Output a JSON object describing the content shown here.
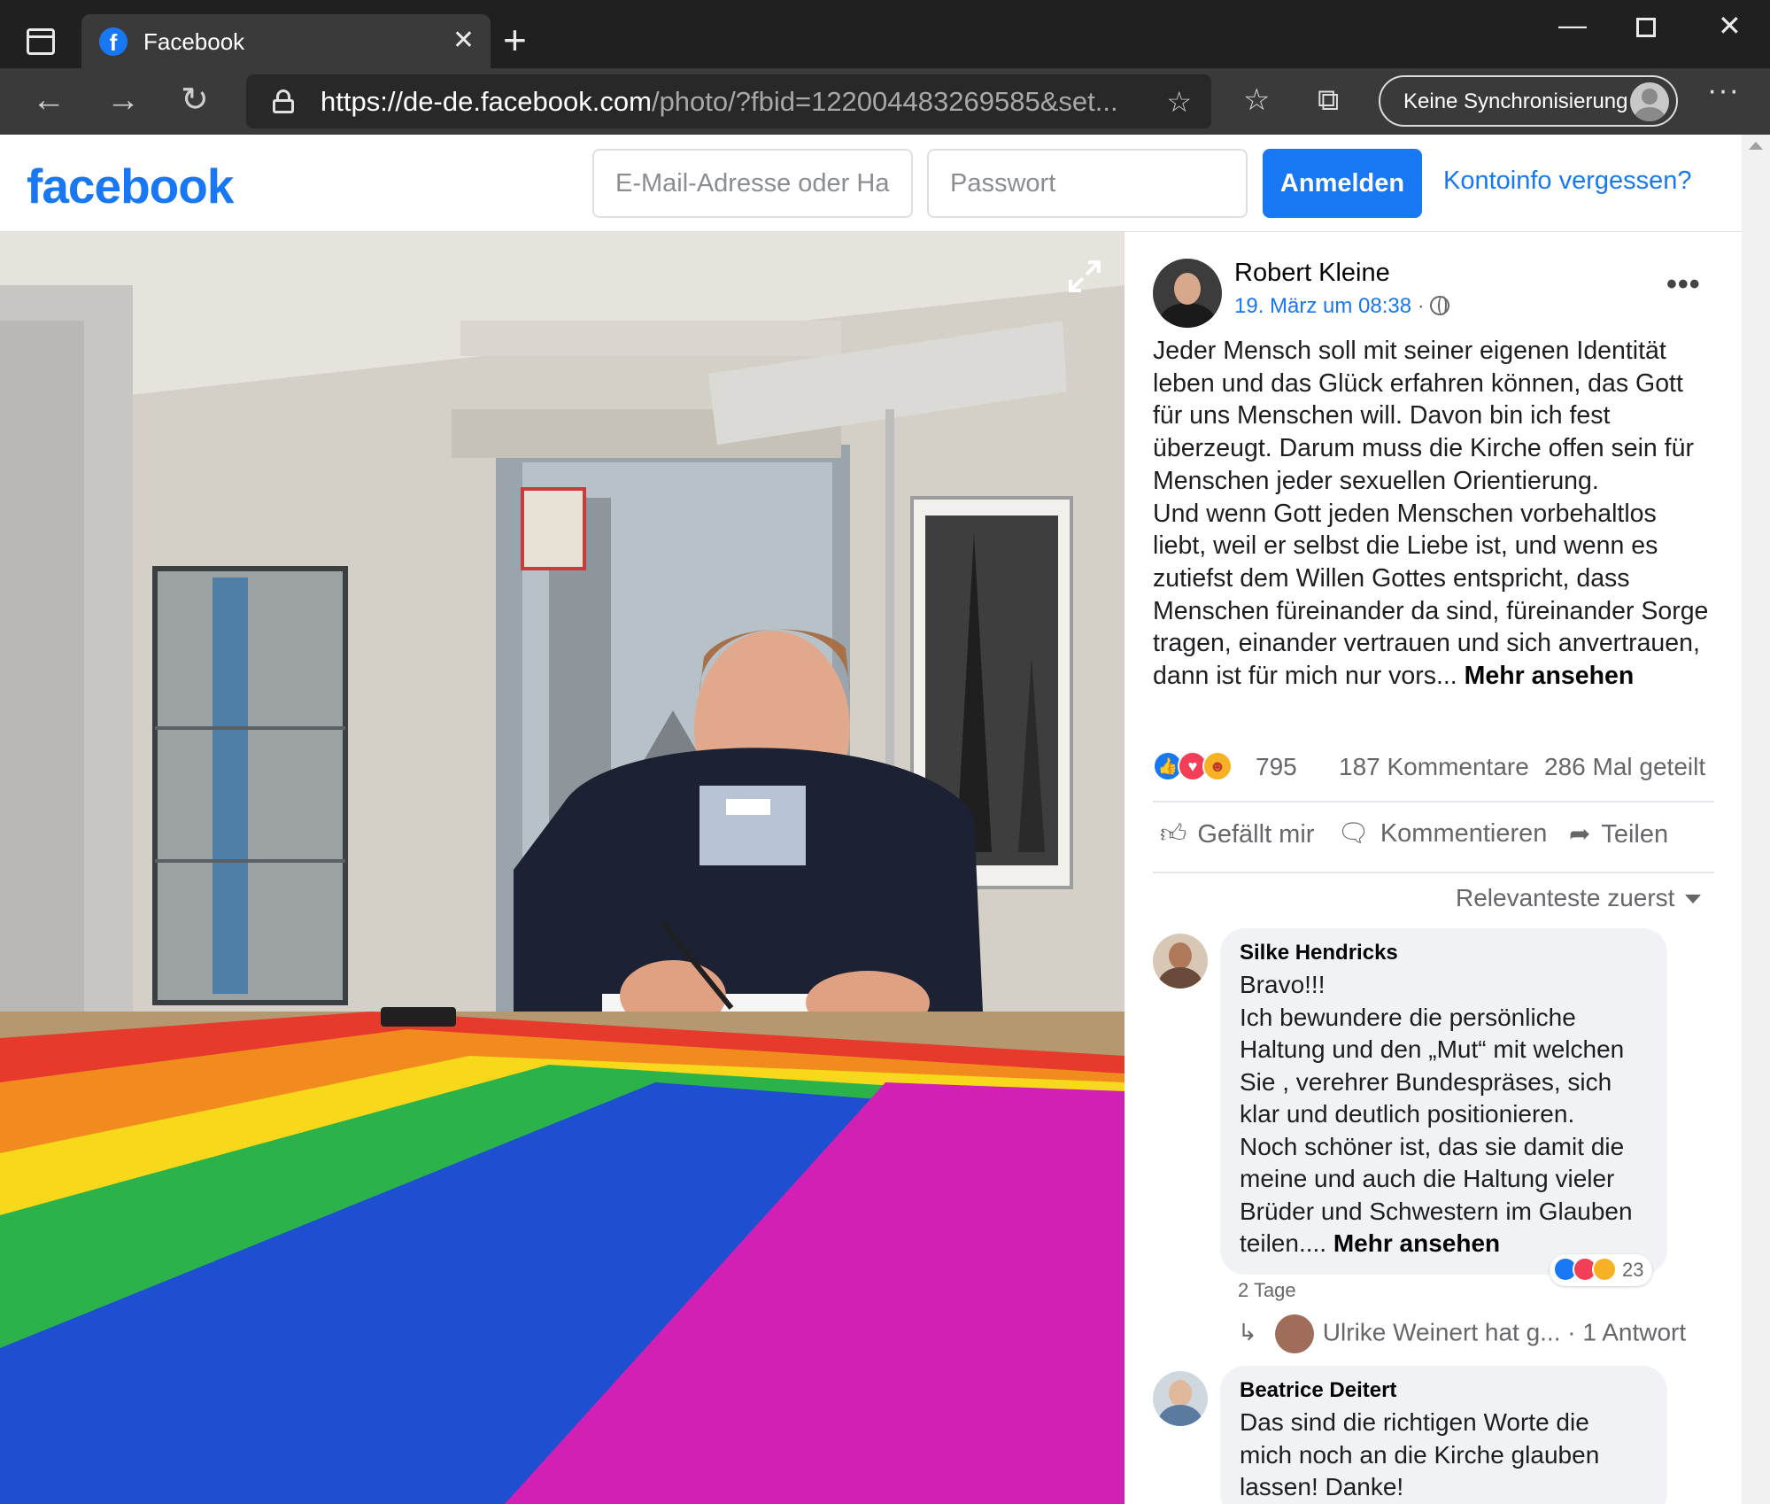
{
  "browser": {
    "tab_title": "Facebook",
    "url_host_prefix": "https://",
    "url_host": "de-de.facebook.com",
    "url_path": "/photo/?fbid=122004483269585&set...",
    "sync_label": "Keine Synchronisierung"
  },
  "fb": {
    "logo": "facebook",
    "email_placeholder": "E-Mail-Adresse oder Ha",
    "password_placeholder": "Passwort",
    "login_label": "Anmelden",
    "forgot_label": "Kontoinfo vergessen?"
  },
  "post": {
    "author": "Robert Kleine",
    "date": "19. März um 08:38",
    "date_suffix": " · ",
    "text": "Jeder Mensch soll mit seiner eigenen Identität\nleben und das Glück erfahren können, das Gott\nfür uns Menschen will. Davon bin ich fest\nüberzeugt. Darum muss die Kirche offen sein für\nMenschen jeder sexuellen Orientierung.\nUnd wenn Gott jeden Menschen vorbehaltlos\nliebt, weil er selbst die Liebe ist, und wenn es\nzutiefst dem Willen Gottes entspricht, dass\nMenschen füreinander da sind, füreinander Sorge\ntragen, einander vertrauen und sich anvertrauen,\ndann ist für mich nur vors... ",
    "see_more": "Mehr ansehen",
    "reaction_count": "795",
    "comment_count": "187 Kommentare",
    "share_count": "286 Mal geteilt",
    "like_label": "Gefällt mir",
    "comment_label": "Kommentieren",
    "share_label": "Teilen",
    "sort_label": "Relevanteste zuerst"
  },
  "comments": [
    {
      "name": "Silke Hendricks",
      "text": "Bravo!!!\nIch bewundere die persönliche\nHaltung und den „Mut“ mit welchen\nSie , verehrer Bundespräses, sich\nklar und deutlich positionieren.\nNoch schöner ist, das sie damit die\nmeine und auch die Haltung vieler\nBrüder und Schwestern im Glauben\nteilen.... ",
      "see_more": "Mehr ansehen",
      "reaction_count": "23",
      "time": "2 Tage",
      "reply_text": "Ulrike Weinert hat g...",
      "reply_count": " · 1 Antwort"
    },
    {
      "name": "Beatrice Deitert",
      "text": "Das sind die richtigen Worte die\nmich noch an die Kirche glauben\nlassen! Danke!"
    }
  ],
  "colors": {
    "fb_blue": "#1877f2",
    "like_blue": "#1877f2",
    "love_red": "#f33e58",
    "care_yellow": "#f7b125"
  }
}
